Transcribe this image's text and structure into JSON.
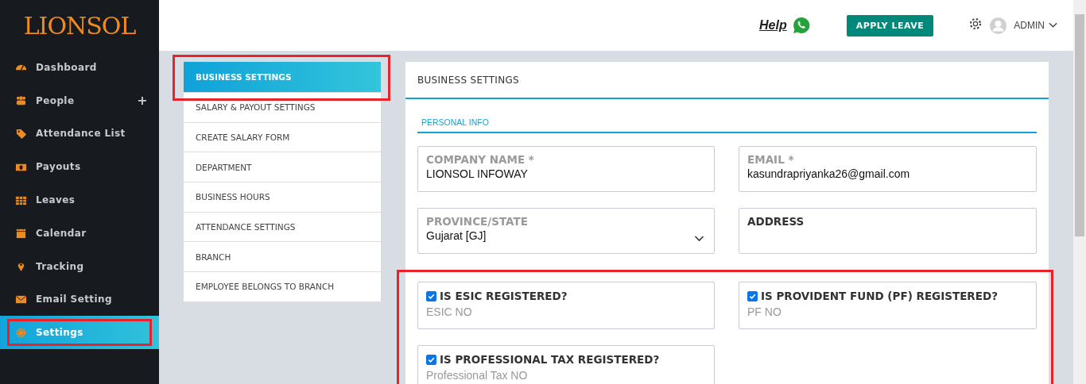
{
  "logo": "LIONSOL",
  "sidebar": {
    "items": [
      {
        "label": "Dashboard",
        "selected": false,
        "highlighted": false
      },
      {
        "label": "People",
        "selected": false,
        "expand_symbol": "+",
        "highlighted": false
      },
      {
        "label": "Attendance List",
        "selected": false,
        "highlighted": false
      },
      {
        "label": "Payouts",
        "selected": false,
        "highlighted": false
      },
      {
        "label": "Leaves",
        "selected": false,
        "highlighted": false
      },
      {
        "label": "Calendar",
        "selected": false,
        "highlighted": false
      },
      {
        "label": "Tracking",
        "selected": false,
        "highlighted": false
      },
      {
        "label": "Email Setting",
        "selected": false,
        "highlighted": false
      },
      {
        "label": "Settings",
        "selected": true,
        "highlighted": true
      }
    ]
  },
  "topbar": {
    "help": "Help",
    "apply_button": "APPLY LEAVE",
    "user": "ADMIN"
  },
  "submenu": [
    {
      "label": "BUSINESS SETTINGS",
      "selected": true,
      "highlighted": true
    },
    {
      "label": "SALARY & PAYOUT SETTINGS",
      "selected": false,
      "highlighted": false
    },
    {
      "label": "CREATE SALARY FORM",
      "selected": false,
      "highlighted": false
    },
    {
      "label": "DEPARTMENT",
      "selected": false,
      "highlighted": false
    },
    {
      "label": "BUSINESS HOURS",
      "selected": false,
      "highlighted": false
    },
    {
      "label": "ATTENDANCE SETTINGS",
      "selected": false,
      "highlighted": false
    },
    {
      "label": "BRANCH",
      "selected": false,
      "highlighted": false
    },
    {
      "label": "EMPLOYEE BELONGS TO BRANCH",
      "selected": false,
      "highlighted": false
    }
  ],
  "card": {
    "title": "BUSINESS SETTINGS",
    "tab": "PERSONAL INFO",
    "fields": [
      {
        "kind": "text",
        "label": "COMPANY NAME *",
        "value": "LIONSOL INFOWAY"
      },
      {
        "kind": "text",
        "label": "EMAIL *",
        "value": "kasundrapriyanka26@gmail.com"
      },
      {
        "kind": "select",
        "label": "PROVINCE/STATE",
        "value": "Gujarat [GJ]"
      },
      {
        "kind": "textarea",
        "label": "ADDRESS"
      }
    ],
    "registrations_highlighted": true,
    "registrations": [
      {
        "label": "IS ESIC REGISTERED?",
        "checked": true,
        "placeholder": "ESIC NO"
      },
      {
        "label": "IS PROVIDENT FUND (PF) REGISTERED?",
        "checked": true,
        "placeholder": "PF NO"
      },
      {
        "label": "IS PROFESSIONAL TAX REGISTERED?",
        "checked": true,
        "placeholder": "Professional Tax NO"
      }
    ]
  }
}
